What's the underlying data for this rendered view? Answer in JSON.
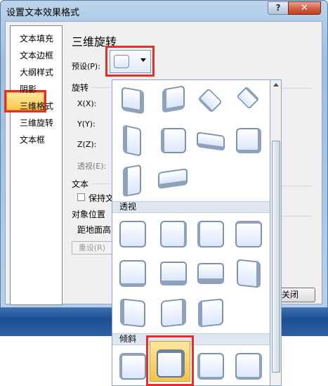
{
  "window": {
    "title": "设置文本效果格式",
    "help_label": "?",
    "close_label": "✕"
  },
  "nav": {
    "items": [
      "文本填充",
      "文本边框",
      "大纲样式",
      "阴影",
      "三维格式",
      "三维旋转",
      "文本框"
    ],
    "selected": "三维旋转"
  },
  "panel": {
    "title": "三维旋转",
    "preset_label": "预设(P):",
    "rotation_group": "旋转",
    "x_label": "X(X):",
    "y_label": "Y(Y):",
    "z_label": "Z(Z):",
    "perspective_label": "透视(E):",
    "text_group": "文本",
    "keep_text_label": "保持文",
    "object_position_group": "对象位置",
    "distance_label": "距地面高",
    "reset_label": "重设(R)",
    "close_button": "关闭"
  },
  "gallery": {
    "sections": [
      "透视",
      "倾斜"
    ],
    "selected_item": "倾斜-2"
  },
  "colors": {
    "highlight_red": "#e0312b",
    "selected_gold": "#f8c64c",
    "shape_blue": "#dbe7fb"
  }
}
